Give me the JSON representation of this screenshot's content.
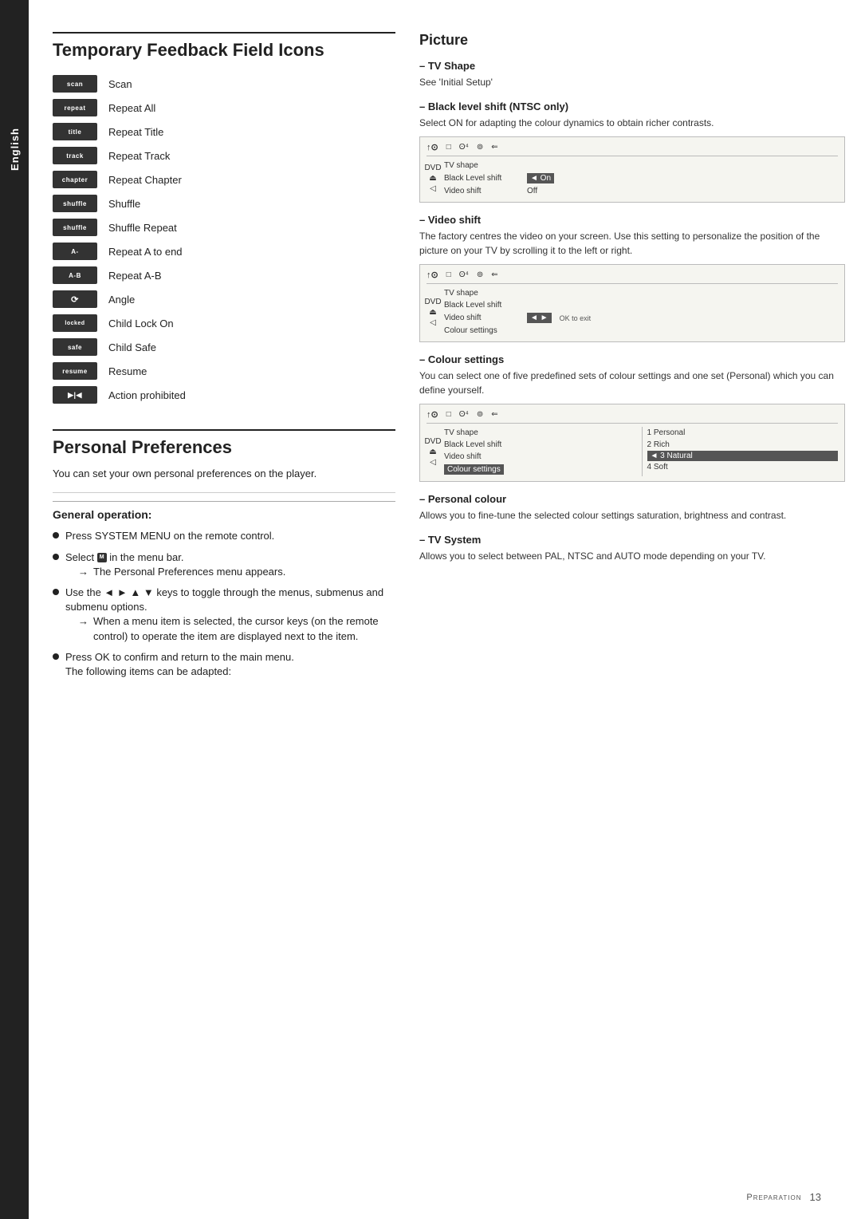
{
  "side_tab": {
    "label": "English"
  },
  "left": {
    "section1_title": "Temporary Feedback Field Icons",
    "icons": [
      {
        "badge": "scan",
        "label": "Scan"
      },
      {
        "badge": "repeat",
        "label": "Repeat All"
      },
      {
        "badge": "title",
        "label": "Repeat Title"
      },
      {
        "badge": "track",
        "label": "Repeat Track"
      },
      {
        "badge": "chapter",
        "label": "Repeat Chapter"
      },
      {
        "badge": "shuffle",
        "label": "Shuffle"
      },
      {
        "badge": "shuffle",
        "label": "Shuffle Repeat"
      },
      {
        "badge": "A-",
        "label": "Repeat A to end"
      },
      {
        "badge": "A-B",
        "label": "Repeat A-B"
      },
      {
        "badge": "∞",
        "label": "Angle"
      },
      {
        "badge": "locked",
        "label": "Child Lock On"
      },
      {
        "badge": "safe",
        "label": "Child Safe"
      },
      {
        "badge": "resume",
        "label": "Resume"
      },
      {
        "badge": "▶|◀",
        "label": "Action prohibited"
      }
    ],
    "section2_title": "Personal Preferences",
    "pref_intro": "You can set your own personal preferences on the player.",
    "general_op_title": "General operation:",
    "bullets": [
      {
        "text": "Press SYSTEM MENU on the remote control.",
        "sub": null
      },
      {
        "text": "Select",
        "icon": "M",
        "after": "in the menu bar.",
        "sub": "→ The Personal Preferences menu appears."
      },
      {
        "text": "Use the ◄ ► ▲ ▼ keys to toggle through the menus, submenus and submenu options.",
        "sub": "→ When a menu item is selected, the cursor keys (on the remote control) to operate the item are displayed next to the item."
      },
      {
        "text": "Press OK to confirm and return to the main menu. The following items can be adapted:",
        "sub": null
      }
    ]
  },
  "right": {
    "picture_title": "Picture",
    "tv_shape_heading": "TV Shape",
    "tv_shape_body": "See 'Initial Setup'",
    "black_level_heading": "Black level shift (NTSC only)",
    "black_level_body": "Select ON for adapting the colour dynamics to obtain richer contrasts.",
    "black_level_menu": {
      "row1": "TV shape",
      "row2": "Black Level shift",
      "row2_val": "◄ On",
      "row3": "Video shift",
      "row3_val": "Off"
    },
    "video_shift_heading": "Video shift",
    "video_shift_body": "The factory centres the video on your screen. Use this setting to personalize the position of the picture on your TV by scrolling it to the left or right.",
    "video_shift_menu": {
      "row1": "TV shape",
      "row2": "Black Level shift",
      "row3": "Video shift",
      "row3_val": "◄►",
      "row4": "Colour settings",
      "ok": "OK to exit"
    },
    "colour_heading": "Colour settings",
    "colour_body": "You can select one of five predefined sets of colour settings and one set (Personal) which you can define yourself.",
    "colour_menu": {
      "row1": "TV shape",
      "row2": "Black Level shift",
      "row3": "Video shift",
      "row4": "Colour settings",
      "options": [
        "1 Personal",
        "2 Rich",
        "◄ 3 Natural",
        "4 Soft"
      ]
    },
    "personal_colour_heading": "Personal colour",
    "personal_colour_body": "Allows you to fine-tune the selected colour settings saturation, brightness and contrast.",
    "tv_system_heading": "TV System",
    "tv_system_body": "Allows you to select between PAL, NTSC and AUTO mode depending on your TV."
  },
  "footer": {
    "label": "Preparation",
    "page": "13"
  }
}
